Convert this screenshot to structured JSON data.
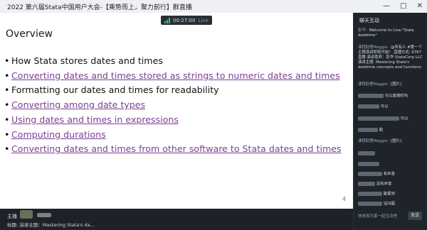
{
  "window": {
    "title": "2022 第六届Stata中国用户大会-【乘势而上，聚力前行】群直播",
    "controls": [
      "—",
      "□",
      "✕"
    ]
  },
  "live_bar": {
    "elapsed": "00:27:00",
    "status": "Live",
    "signal_color": "#2ecc71"
  },
  "toolbar_icons": [
    "share-screen-icon",
    "share-icon",
    "more-icon"
  ],
  "slide": {
    "title": "Overview",
    "page_number": "4",
    "bullets": [
      {
        "text": "How Stata stores dates and times",
        "link": false
      },
      {
        "text": "Converting dates and times stored as strings to numeric dates and times",
        "link": true
      },
      {
        "text": "Formatting our dates and times for readability",
        "link": false
      },
      {
        "text": "Converting among date types",
        "link": true
      },
      {
        "text": "Using dates and times in expressions",
        "link": true
      },
      {
        "text": "Computing durations",
        "link": true
      },
      {
        "text": "Converting dates and times from other software to Stata dates and times",
        "link": true
      }
    ],
    "link_color": "#7b3f94"
  },
  "bottom": {
    "host_label": "主播",
    "topic_label": "标题: 演讲主题：Mastering Stata's da..."
  },
  "chat": {
    "header": "聊天互动",
    "messages": [
      {
        "who": "彭华:",
        "text": "Welcome to Live:\"Stata datetime\""
      },
      {
        "who": "课程助理Maggie:",
        "text": "@所有人 #第一个主题演讲即将开始！ 直播方式: 6767直播 演讲嘉宾：彭华 StataCorp LLC 演讲主题: Mastering Stata's datetime concepts and functions"
      },
      {
        "who": "课程助理Maggie:",
        "text": "[图片]"
      },
      {
        "who": "",
        "text": "可以直接听吗"
      },
      {
        "who": "",
        "text": "可以"
      },
      {
        "who": "",
        "text": "可以"
      },
      {
        "who": "",
        "text": "能"
      },
      {
        "who": "课程助理Maggie:",
        "text": "[图片]"
      },
      {
        "who": "",
        "text": "有声音"
      },
      {
        "who": "",
        "text": "没有声音"
      },
      {
        "who": "",
        "text": "能看到"
      },
      {
        "who": "",
        "text": "没问题"
      }
    ],
    "input_placeholder": "快来和大家一起互动吧",
    "send_label": "发送"
  }
}
